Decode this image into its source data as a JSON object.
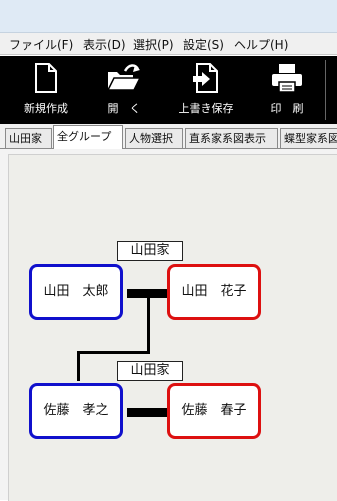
{
  "menu": [
    "ファイル(F)",
    "表示(D)",
    "選択(P)",
    "設定(S)",
    "ヘルプ(H)"
  ],
  "toolbar": {
    "new_label": "新規作成",
    "open_label": "開　く",
    "save_label": "上書き保存",
    "print_label": "印　刷"
  },
  "tabs": [
    "山田家",
    "全グループ",
    "人物選択",
    "直系家系図表示",
    "蝶型家系図"
  ],
  "active_tab": "全グループ",
  "tree": {
    "family_1_label": "山田家",
    "family_2_label": "山田家",
    "persons": [
      {
        "name": "山田　太郎",
        "gender": "male"
      },
      {
        "name": "山田　花子",
        "gender": "female"
      },
      {
        "name": "佐藤　孝之",
        "gender": "male"
      },
      {
        "name": "佐藤　春子",
        "gender": "female"
      }
    ]
  },
  "colors": {
    "male_border": "#1010cc",
    "female_border": "#dd1010",
    "toolbar_bg": "#000000"
  }
}
